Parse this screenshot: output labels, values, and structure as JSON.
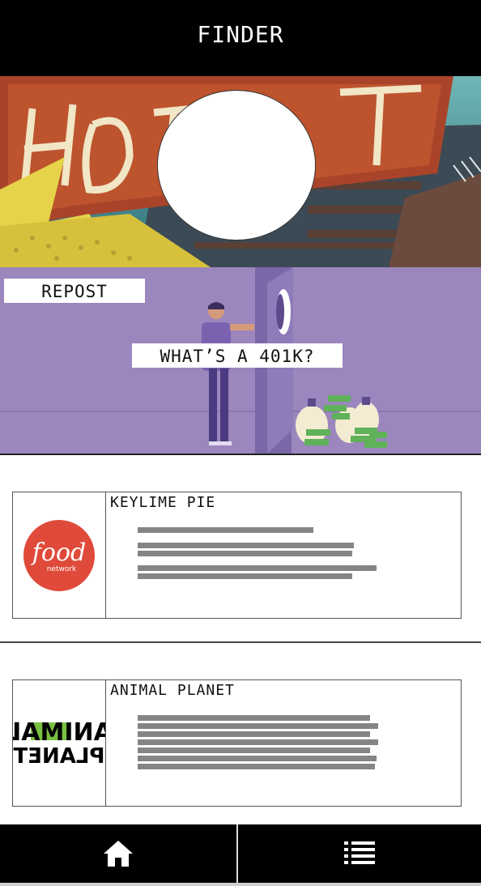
{
  "header": {
    "title": "FINDER"
  },
  "hero": {
    "sign_text": "HOTEL"
  },
  "promo": {
    "repost_label": "REPOST",
    "caption": "WHAT’S A 401K?"
  },
  "cards": [
    {
      "title": "KEYLIME PIE",
      "logo_text": "food",
      "logo_subtext": "network",
      "logo_color": "#e04a3a"
    },
    {
      "title": "ANIMAL PLANET",
      "logo_text_top": "ANIMAL",
      "logo_text_bottom": "PLANET",
      "logo_accent": "#7ac043"
    }
  ],
  "footer": {
    "items": [
      {
        "icon": "home-icon"
      },
      {
        "icon": "list-icon"
      }
    ]
  },
  "colors": {
    "header_bg": "#000000",
    "promo_bg": "#9b87bd",
    "text_line": "#858585"
  }
}
